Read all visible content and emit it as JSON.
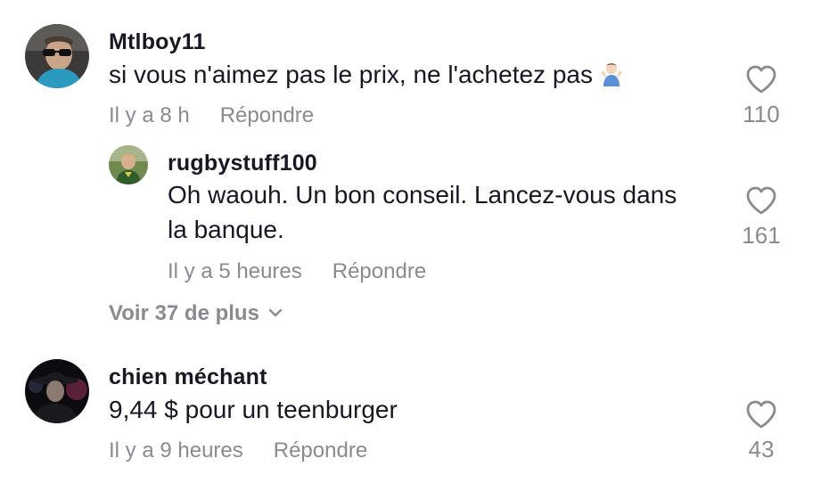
{
  "comments": [
    {
      "username": "Mtlboy11",
      "text": "si vous n'aimez pas le prix, ne l'achetez pas",
      "emoji": "person-shrugging-emoji",
      "time": "Il y a 8 h",
      "reply_label": "Répondre",
      "like_count": "110",
      "replies": [
        {
          "username": "rugbystuff100",
          "text_line1": "Oh waouh. Un bon conseil. Lancez-vous dans",
          "text_line2": "la banque.",
          "time": "Il y a 5 heures",
          "reply_label": "Répondre",
          "like_count": "161"
        }
      ],
      "view_more_label": "Voir 37 de plus"
    },
    {
      "username": "chien méchant",
      "text": "9,44 $ pour un teenburger",
      "time": "Il y a 9 heures",
      "reply_label": "Répondre",
      "like_count": "43"
    }
  ],
  "colors": {
    "text_primary": "#161823",
    "text_secondary": "#8a8b91",
    "background": "#ffffff"
  },
  "icons": {
    "like": "heart-outline-icon",
    "expand": "chevron-down-icon"
  }
}
